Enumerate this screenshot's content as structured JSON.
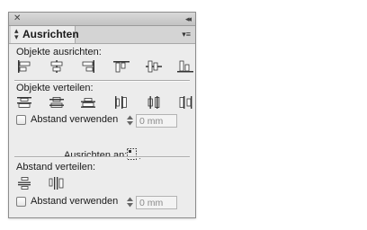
{
  "panel": {
    "tab_label": "Ausrichten",
    "icons": {
      "close": "close-icon",
      "collapse": "collapse-double-arrow-icon",
      "menu": "panel-menu-icon",
      "tab_arrows": "tab-updown-arrows-icon"
    }
  },
  "sections": {
    "align_objects": {
      "title": "Objekte ausrichten:",
      "buttons": [
        "align-left-edges",
        "align-horizontal-centers",
        "align-right-edges",
        "align-top-edges",
        "align-vertical-centers",
        "align-bottom-edges"
      ]
    },
    "distribute_objects": {
      "title": "Objekte verteilen:",
      "buttons": [
        "distribute-top-edges",
        "distribute-vertical-centers",
        "distribute-bottom-edges",
        "distribute-left-edges",
        "distribute-horizontal-centers",
        "distribute-right-edges"
      ],
      "use_spacing_label": "Abstand verwenden",
      "spacing_value": "0 mm",
      "use_spacing_checked": false
    },
    "align_to": {
      "label": "Ausrichten an:",
      "icon": "align-to-selection-icon"
    },
    "distribute_spacing": {
      "title": "Abstand verteilen:",
      "buttons": [
        "distribute-vertical-space",
        "distribute-horizontal-space"
      ],
      "use_spacing_label": "Abstand verwenden",
      "spacing_value": "0 mm",
      "use_spacing_checked": false
    }
  }
}
